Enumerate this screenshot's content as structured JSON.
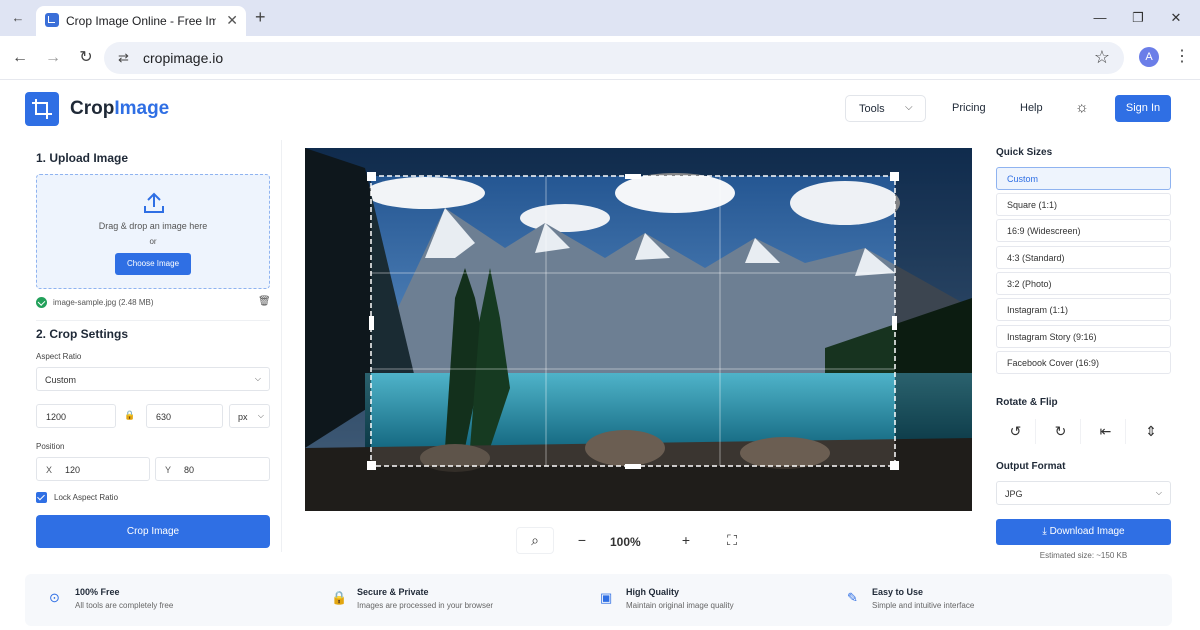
{
  "browser": {
    "tab_title": "Crop Image Online - Free Image",
    "url": "cropimage.io",
    "profile_initial": "A"
  },
  "header": {
    "brand_part1": "Crop",
    "brand_part2": "Image",
    "nav": {
      "tools": "Tools",
      "pricing": "Pricing",
      "help": "Help"
    },
    "signin": "Sign In",
    "accent_color": "#2f6fe4"
  },
  "upload": {
    "title": "1. Upload Image",
    "drop_text": "Drag & drop an image here",
    "or": "or",
    "button": "Choose Image",
    "file_name": "image-sample.jpg (2.48 MB)"
  },
  "crop_settings": {
    "title": "2. Crop Settings",
    "aspect_label": "Aspect Ratio",
    "aspect_value": "Custom",
    "width": "1200",
    "height": "630",
    "unit": "px",
    "position_label": "Position",
    "x_label": "X",
    "x_value": "120",
    "y_label": "Y",
    "y_value": "80",
    "lock_label": "Lock Aspect Ratio",
    "crop_button": "Crop Image"
  },
  "zoom": {
    "value": "100%"
  },
  "quick_sizes": {
    "title": "Quick Sizes",
    "items": [
      "Custom",
      "Square (1:1)",
      "16:9 (Widescreen)",
      "4:3 (Standard)",
      "3:2 (Photo)",
      "Instagram (1:1)",
      "Instagram Story (9:16)",
      "Facebook Cover (16:9)"
    ]
  },
  "rotate_flip": {
    "title": "Rotate & Flip"
  },
  "output": {
    "title": "Output Format",
    "format": "JPG",
    "download": "Download Image",
    "estimated": "Estimated size: ~150 KB"
  },
  "features": [
    {
      "title": "100% Free",
      "sub": "All tools are completely free"
    },
    {
      "title": "Secure & Private",
      "sub": "Images are processed in your browser"
    },
    {
      "title": "High Quality",
      "sub": "Maintain original image quality"
    },
    {
      "title": "Easy to Use",
      "sub": "Simple and intuitive interface"
    }
  ]
}
